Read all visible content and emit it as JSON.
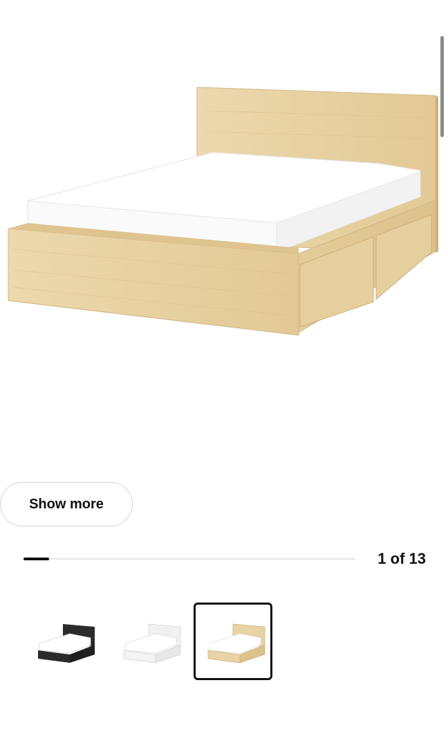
{
  "product": {
    "main_image": "bed-frame-with-storage-oak-veneer",
    "colors": {
      "oak": "#e8d3a6",
      "oak_dark": "#d9bf8c",
      "black": "#2b2b2b",
      "white": "#f3f3f3",
      "mattress": "#ffffff"
    }
  },
  "gallery": {
    "show_more_label": "Show more",
    "counter_text": "1 of 13",
    "current_index": 1,
    "total_images": 13,
    "progress_fraction": 0.077
  },
  "variants": [
    {
      "name": "black-brown",
      "icon": "bed-thumbnail-black",
      "selected": false
    },
    {
      "name": "white",
      "icon": "bed-thumbnail-white",
      "selected": false
    },
    {
      "name": "white-stained-oak-veneer",
      "icon": "bed-thumbnail-oak",
      "selected": true
    }
  ]
}
